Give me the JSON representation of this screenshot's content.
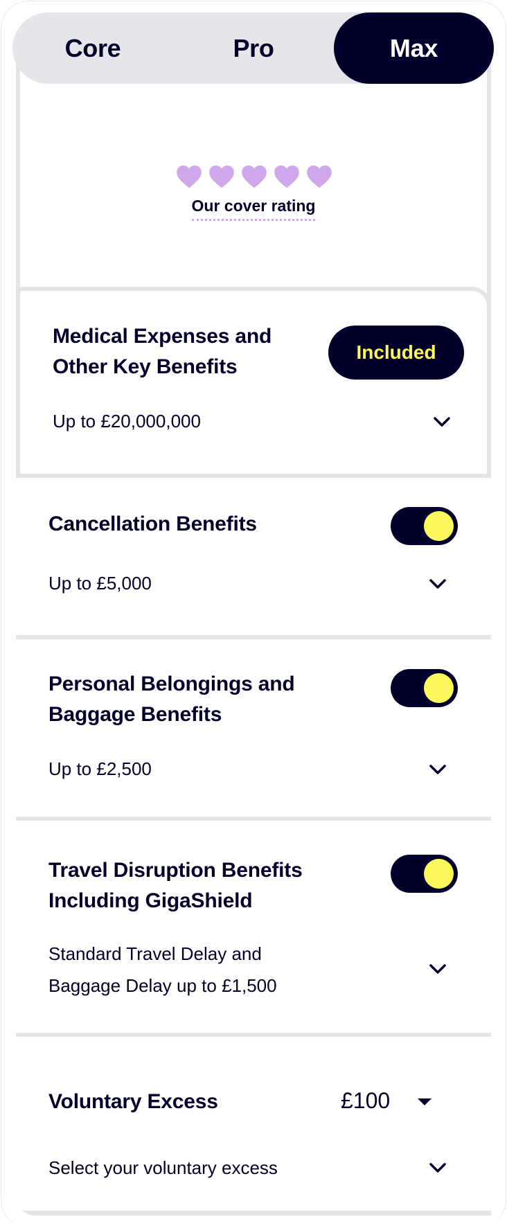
{
  "tabs": [
    {
      "label": "Core",
      "selected": false
    },
    {
      "label": "Pro",
      "selected": false
    },
    {
      "label": "Max",
      "selected": true
    }
  ],
  "rating": {
    "label": "Our cover rating",
    "hearts_filled": 5,
    "hearts_total": 5,
    "heart_color": "#cfa8ec"
  },
  "benefits": [
    {
      "title": "Medical Expenses and Other Key Benefits",
      "title_lines": [
        "Medical Expenses and",
        "Other Key Benefits"
      ],
      "status_label": "Included",
      "description_lines": [
        "Up to £20,000,000"
      ]
    },
    {
      "title": "Cancellation Benefits",
      "title_lines": [
        "Cancellation Benefits"
      ],
      "toggle_on": true,
      "description_lines": [
        "Up to £5,000"
      ]
    },
    {
      "title": "Personal Belongings and Baggage Benefits",
      "title_lines": [
        "Personal Belongings and",
        "Baggage Benefits"
      ],
      "toggle_on": true,
      "description_lines": [
        "Up to £2,500"
      ]
    },
    {
      "title": "Travel Disruption Benefits Including GigaShield",
      "title_lines": [
        "Travel Disruption Benefits",
        "Including GigaShield"
      ],
      "toggle_on": true,
      "description_lines": [
        "Standard Travel Delay and",
        "Baggage Delay up to £1,500"
      ]
    }
  ],
  "excess": {
    "title": "Voluntary Excess",
    "selected_value": "£100",
    "description": "Select your voluntary excess"
  },
  "colors": {
    "navy": "#02002b",
    "yellow": "#fdf95c",
    "lilac": "#cfa8ec",
    "grey_border": "#e4e3e8",
    "tab_bg": "#e6e5ea"
  }
}
